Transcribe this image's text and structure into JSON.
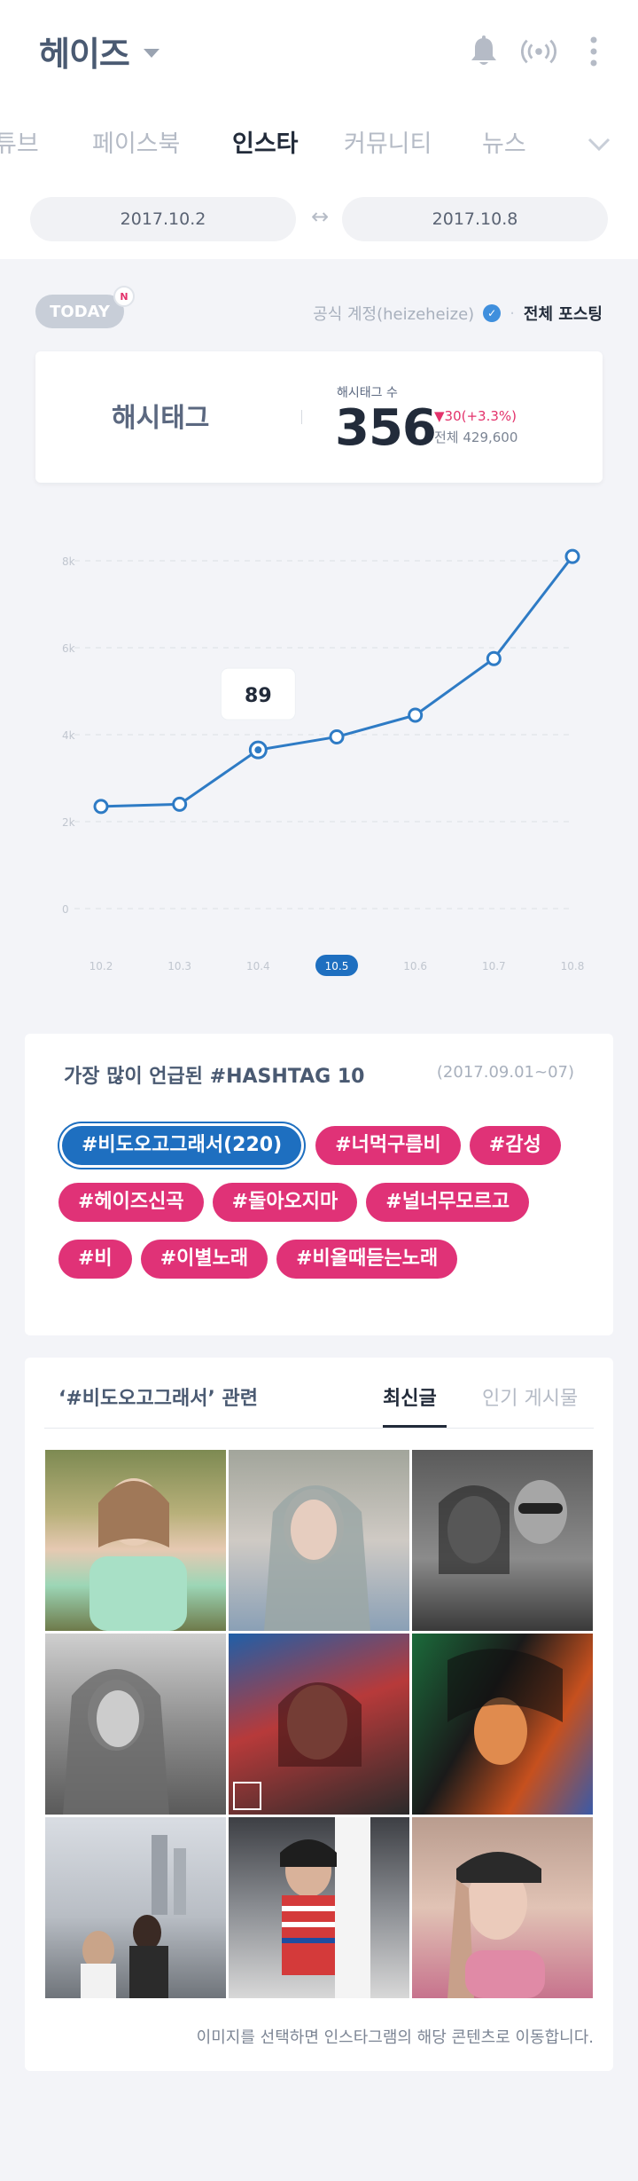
{
  "header": {
    "title": "헤이즈",
    "icons": [
      "bell-icon",
      "broadcast-icon",
      "more-vert-icon"
    ]
  },
  "tabs": [
    {
      "label": "튜브",
      "active": false
    },
    {
      "label": "페이스북",
      "active": false
    },
    {
      "label": "인스타",
      "active": true
    },
    {
      "label": "커뮤니티",
      "active": false
    },
    {
      "label": "뉴스",
      "active": false
    }
  ],
  "date_range": {
    "start": "2017.10.2",
    "end": "2017.10.8",
    "arrow": "↔"
  },
  "today": {
    "badge": "TODAY",
    "new_badge": "N",
    "official_account": "공식 계정(heizeheize)",
    "all_posting": "전체 포스팅"
  },
  "stat": {
    "label": "해시태그",
    "sub_label": "해시태그 수",
    "value": "356",
    "change": "▼30(+3.3%)",
    "total": "전체 429,600"
  },
  "chart_data": {
    "type": "line",
    "x": [
      "10.2",
      "10.3",
      "10.4",
      "10.5",
      "10.6",
      "10.7",
      "10.8"
    ],
    "y_ticks": [
      "0",
      "2k",
      "4k",
      "6k",
      "8k"
    ],
    "ylim": [
      0,
      8000
    ],
    "series": [
      {
        "values": [
          2350,
          2400,
          3650,
          3950,
          4450,
          5750,
          8100
        ]
      }
    ],
    "highlight_index": 2,
    "highlight_label": "89",
    "selected_x_index": 3,
    "grid": true,
    "colors": {
      "line": "#2e7bc5",
      "selected_tick_bg": "#1e6fc0"
    }
  },
  "hashtags": {
    "title": "가장 많이 언급된 #HASHTAG 10",
    "range": "(2017.09.01~07)",
    "tags": [
      "#비도오고그래서(220)",
      "#너먹구름비",
      "#감성",
      "#헤이즈신곡",
      "#돌아오지마",
      "#널너무모르고",
      "#비",
      "#이별노래",
      "#비올때듣는노래"
    ],
    "colors": {
      "primary": "#1e6fc0",
      "tag": "#e03277"
    }
  },
  "posts": {
    "title": "‘#비도오고그래서’ 관련",
    "tab_latest": "최신글",
    "tab_popular": "인기 게시물",
    "footnote": "이미지를 선택하면 인스타그램의 해당 콘텐츠로 이동합니다."
  }
}
